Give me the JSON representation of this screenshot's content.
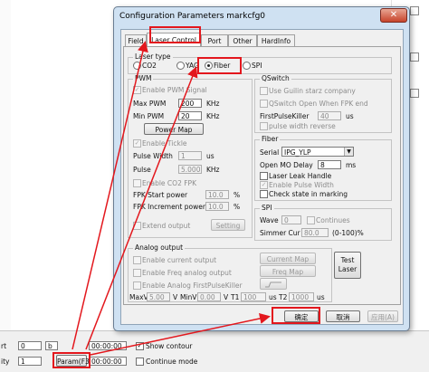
{
  "background": {
    "bottom_panel": {
      "row1_label": "rt",
      "row1_value": "0",
      "row1_value2": "b",
      "row1_time": "00:00:00",
      "show_contour": "Show contour",
      "row2_label": "ity",
      "row2_value": "1",
      "param_button": "Param(F3)",
      "row2_time": "00:00:00",
      "continue_mode": "Continue mode"
    }
  },
  "dialog": {
    "title": "Configuration Parameters markcfg0",
    "close_glyph": "✕",
    "tabs": [
      "Field",
      "Laser Control",
      "Port",
      "Other",
      "HardInfo"
    ],
    "laser_type": {
      "label": "Laser type",
      "options": [
        "CO2",
        "YAG",
        "Fiber",
        "SPI"
      ],
      "selected": "Fiber"
    },
    "pwm": {
      "label": "PWM",
      "enable_pwm_signal": "Enable PWM Signal",
      "max_pwm_label": "Max PWM",
      "max_pwm_value": "200",
      "max_pwm_unit": "KHz",
      "min_pwm_label": "Min PWM",
      "min_pwm_value": "20",
      "min_pwm_unit": "KHz",
      "power_map": "Power Map",
      "enable_tickle": "Enable Tickle",
      "pulse_width_label": "Pulse Width",
      "pulse_width_value": "1",
      "pulse_width_unit": "us",
      "pulse_label": "Pulse",
      "pulse_value": "5.000",
      "pulse_unit": "KHz",
      "enable_co2_fpk": "Enable CO2 FPK",
      "fpk_start_label": "FPK Start power",
      "fpk_start_value": "10.0",
      "fpk_start_unit": "%",
      "fpk_inc_label": "FPK Increment power",
      "fpk_inc_value": "10.0",
      "fpk_inc_unit": "%",
      "extend_output": "Extend output",
      "setting": "Setting"
    },
    "qswitch": {
      "label": "QSwitch",
      "use_guilin": "Use Guilin starz company",
      "qswitch_open": "QSwitch Open When FPK end",
      "first_pulse_label": "FirstPulseKiller",
      "first_pulse_value": "40",
      "first_pulse_unit": "us",
      "pulse_width_reverse": "pulse width reverse"
    },
    "fiber": {
      "label": "Fiber",
      "serial_label": "Serial",
      "serial_value": "IPG_YLP",
      "open_mo_label": "Open MO Delay",
      "open_mo_value": "8",
      "open_mo_unit": "ms",
      "laser_leak": "Laser Leak Handle",
      "enable_pulse_width": "Enable Pulse Width",
      "check_state": "Check state in marking"
    },
    "spi": {
      "label": "SPI",
      "wave_label": "Wave",
      "wave_value": "0",
      "continues": "Continues",
      "simmer_label": "Simmer Cur",
      "simmer_value": "80.0",
      "simmer_unit": "(0-100)%"
    },
    "analog": {
      "label": "Analog output",
      "enable_current": "Enable current output",
      "current_map": "Current Map",
      "enable_freq": "Enable Freq analog output",
      "freq_map": "Freq Map",
      "enable_analog_fpk": "Enable Analog FirstPulseKiller",
      "max_v_label": "MaxV",
      "max_v_value": "5.00",
      "v1_unit": "V",
      "min_v_label": "MinV",
      "min_v_value": "0.00",
      "v2_unit": "V",
      "t1_label": "T1",
      "t1_value": "100",
      "us1": "us",
      "t2_label": "T2",
      "t2_value": "1000",
      "us2": "us"
    },
    "test_laser": "Test\nLaser",
    "ok": "确定",
    "cancel": "取消",
    "apply": "应用(A)"
  },
  "colors": {
    "highlight_red": "#e3171d",
    "dialog_frame": "#cfe1f2"
  }
}
